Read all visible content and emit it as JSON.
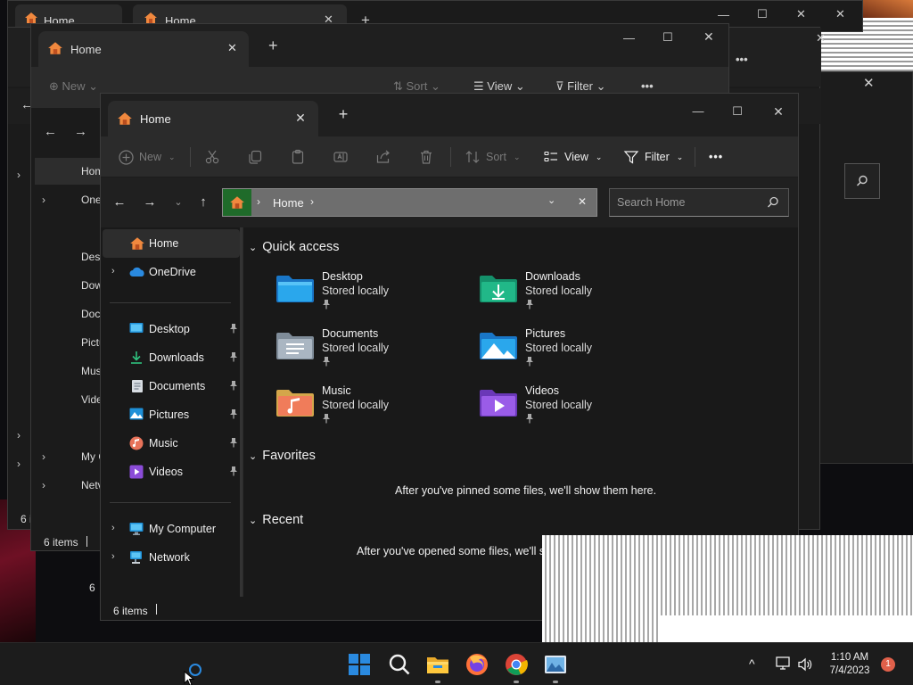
{
  "window": {
    "tab_title": "Home",
    "new_tab_symbol": "+",
    "close_tab_symbol": "✕",
    "minimize_symbol": "—",
    "maximize_symbol": "☐",
    "close_symbol": "✕"
  },
  "toolbar": {
    "new_label": "New",
    "sort_label": "Sort",
    "view_label": "View",
    "filter_label": "Filter",
    "more_label": "•••"
  },
  "address": {
    "crumb_home": "Home",
    "separator": "›",
    "search_placeholder": "Search Home"
  },
  "sidebar": {
    "items": [
      {
        "label": "Home",
        "icon": "home-icon",
        "selected": true
      },
      {
        "label": "OneDrive",
        "icon": "onedrive-icon",
        "expandable": true
      },
      {
        "label": "Desktop",
        "icon": "desktop-folder-icon",
        "pinned": true
      },
      {
        "label": "Downloads",
        "icon": "downloads-folder-icon",
        "pinned": true
      },
      {
        "label": "Documents",
        "icon": "documents-folder-icon",
        "pinned": true
      },
      {
        "label": "Pictures",
        "icon": "pictures-folder-icon",
        "pinned": true
      },
      {
        "label": "Music",
        "icon": "music-folder-icon",
        "pinned": true
      },
      {
        "label": "Videos",
        "icon": "videos-folder-icon",
        "pinned": true
      },
      {
        "label": "My Computer",
        "icon": "computer-icon",
        "expandable": true
      },
      {
        "label": "Network",
        "icon": "network-icon",
        "expandable": true
      }
    ]
  },
  "content": {
    "quick_access_title": "Quick access",
    "quick_access": [
      {
        "name": "Desktop",
        "sub": "Stored locally",
        "icon": "desktop-folder-icon"
      },
      {
        "name": "Downloads",
        "sub": "Stored locally",
        "icon": "downloads-folder-icon"
      },
      {
        "name": "Documents",
        "sub": "Stored locally",
        "icon": "documents-folder-icon"
      },
      {
        "name": "Pictures",
        "sub": "Stored locally",
        "icon": "pictures-folder-icon"
      },
      {
        "name": "Music",
        "sub": "Stored locally",
        "icon": "music-folder-icon"
      },
      {
        "name": "Videos",
        "sub": "Stored locally",
        "icon": "videos-folder-icon"
      }
    ],
    "favorites_title": "Favorites",
    "favorites_empty": "After you've pinned some files, we'll show them here.",
    "recent_title": "Recent",
    "recent_empty": "After you've opened some files, we'll sh"
  },
  "status": {
    "items_count": "6 items"
  },
  "ghost_windows": {
    "tab_title": "Home",
    "status_text": "6 items",
    "side_labels": [
      "Hom",
      "One",
      "Desk",
      "Dow",
      "Doc",
      "Pictu",
      "Mus",
      "Vide",
      "My C",
      "Netv"
    ],
    "status_partial": "6 it",
    "status_partial_2": "6"
  },
  "taskbar": {
    "apps": [
      "start-icon",
      "search-icon",
      "file-explorer-icon",
      "firefox-icon",
      "chrome-icon",
      "image-viewer-icon"
    ],
    "time": "1:10 AM",
    "date": "7/4/2023",
    "notification_count": "1"
  },
  "colors": {
    "accent_home": "#f0883e",
    "address_home_bg": "#1f6b2a",
    "notif_badge": "#e0604a"
  }
}
